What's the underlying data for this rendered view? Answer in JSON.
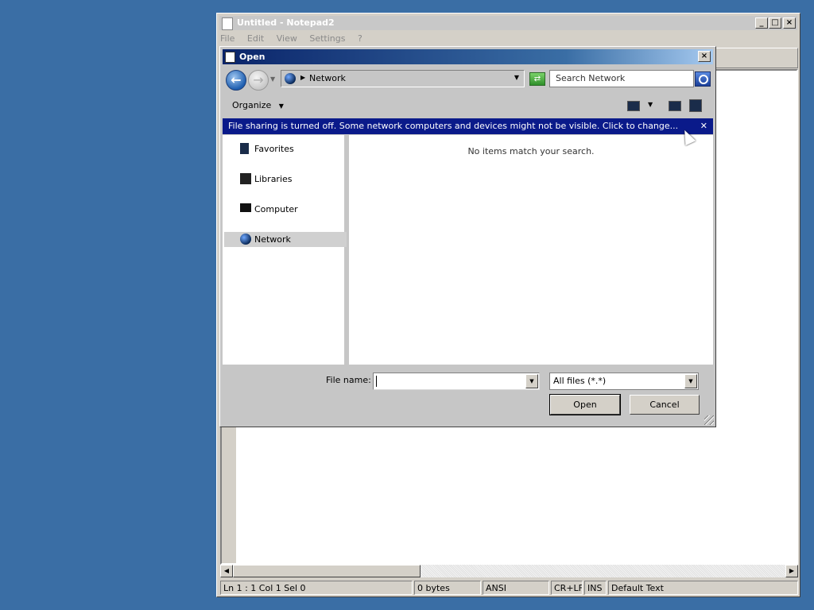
{
  "notepad": {
    "title": "Untitled - Notepad2",
    "menu": [
      "File",
      "Edit",
      "View",
      "Settings",
      "?"
    ],
    "status": {
      "position": "Ln 1 : 1   Col 1   Sel 0",
      "size": "0 bytes",
      "encoding": "ANSI",
      "line_endings": "CR+LF",
      "mode": "INS",
      "scheme": "Default Text"
    }
  },
  "dialog": {
    "title": "Open",
    "address": "Network",
    "search_placeholder": "Search Network",
    "organize_label": "Organize",
    "infobar_text": "File sharing is turned off. Some network computers and devices might not be visible. Click to change...",
    "nav_items": [
      {
        "label": "Favorites",
        "icon": "favorites-icon"
      },
      {
        "label": "Libraries",
        "icon": "libraries-icon"
      },
      {
        "label": "Computer",
        "icon": "computer-icon"
      },
      {
        "label": "Network",
        "icon": "network-icon",
        "selected": true
      }
    ],
    "empty_message": "No items match your search.",
    "file_name_label": "File name:",
    "file_name_value": "",
    "file_type": "All files (*.*)",
    "open_label": "Open",
    "cancel_label": "Cancel"
  }
}
